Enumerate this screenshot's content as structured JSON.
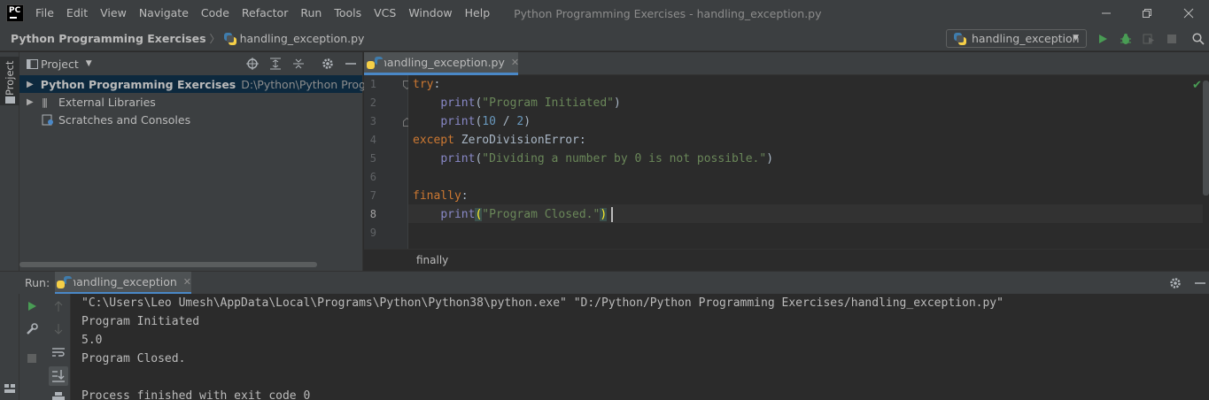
{
  "app": {
    "logo_text": "PC",
    "window_title": "Python Programming Exercises - handling_exception.py",
    "menu": [
      "File",
      "Edit",
      "View",
      "Navigate",
      "Code",
      "Refactor",
      "Run",
      "Tools",
      "VCS",
      "Window",
      "Help"
    ]
  },
  "navbar": {
    "project": "Python Programming Exercises",
    "file": "handling_exception.py",
    "run_config": "handling_exception"
  },
  "stripe": {
    "project_label": "Project"
  },
  "project_panel": {
    "title": "Project",
    "tree": [
      {
        "label": "Python Programming Exercises",
        "path": "D:\\Python\\Python Programmin"
      },
      {
        "label": "External Libraries"
      },
      {
        "label": "Scratches and Consoles"
      }
    ]
  },
  "editor": {
    "tab_label": "handling_exception.py",
    "line_numbers": [
      "1",
      "2",
      "3",
      "4",
      "5",
      "6",
      "7",
      "8",
      "9"
    ],
    "current_line": 8,
    "code": [
      [
        "try",
        ":"
      ],
      [
        "    ",
        "print",
        "(",
        "\"Program Initiated\"",
        ")"
      ],
      [
        "    ",
        "print",
        "(",
        "10",
        " / ",
        "2",
        ")"
      ],
      [
        "except",
        " ZeroDivisionError:"
      ],
      [
        "    ",
        "print",
        "(",
        "\"Dividing a number by 0 is not possible.\"",
        ")"
      ],
      [],
      [
        "finally",
        ":"
      ],
      [
        "    ",
        "print",
        "(",
        "\"Program Closed.\"",
        ")"
      ],
      []
    ],
    "breadcrumb": "finally"
  },
  "run": {
    "label": "Run:",
    "tab_label": "handling_exception",
    "console": [
      "\"C:\\Users\\Leo Umesh\\AppData\\Local\\Programs\\Python\\Python38\\python.exe\" \"D:/Python/Python Programming Exercises/handling_exception.py\"",
      "Program Initiated",
      "5.0",
      "Program Closed.",
      "",
      "Process finished with exit code 0"
    ]
  },
  "colors": {
    "keyword": "#cc7832",
    "builtin": "#8888c6",
    "string": "#6a8759",
    "number": "#6897bb",
    "run_green": "#499c54",
    "accent": "#4a88c7"
  }
}
